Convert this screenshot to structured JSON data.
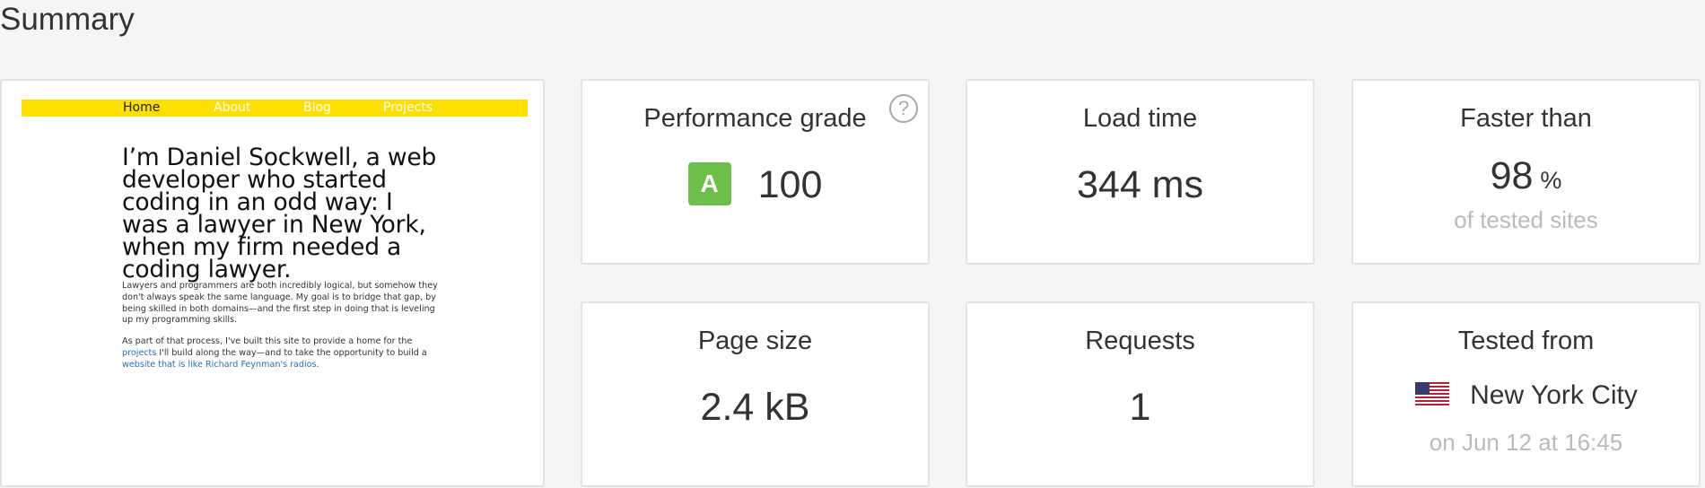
{
  "summary": {
    "title": "Summary"
  },
  "screenshot": {
    "nav": [
      "Home",
      "About",
      "Blog",
      "Projects"
    ],
    "heading": "I’m Daniel Sockwell, a web developer who started coding in an odd way: I was a lawyer in New York, when my firm needed a coding lawyer.",
    "para1": "Lawyers and programmers are both incredibly logical, but somehow they don't always speak the same language. My goal is to bridge that gap, by being skilled in both domains—and the first step in doing that is leveling up my programming skills.",
    "para2_a": "As part of that process, I've built this site to provide a home for the ",
    "para2_link1": "projects",
    "para2_b": " I'll build along the way—and to take the opportunity to build a ",
    "para2_link2": "website that is like Richard Feynman's radios",
    "para2_c": "."
  },
  "performance": {
    "label": "Performance grade",
    "grade": "A",
    "score": "100",
    "help": "?"
  },
  "load_time": {
    "label": "Load time",
    "value": "344 ms"
  },
  "faster_than": {
    "label": "Faster than",
    "value": "98",
    "unit": "%",
    "sub": "of tested sites"
  },
  "page_size": {
    "label": "Page size",
    "value": "2.4 kB"
  },
  "requests": {
    "label": "Requests",
    "value": "1"
  },
  "tested_from": {
    "label": "Tested from",
    "location": "New York City",
    "date": "on Jun 12 at 16:45",
    "flag_icon": "us-flag-icon"
  },
  "colors": {
    "grade_green": "#6cc04a",
    "nav_yellow": "#ffdf00",
    "link_blue": "#2a6fb3"
  }
}
